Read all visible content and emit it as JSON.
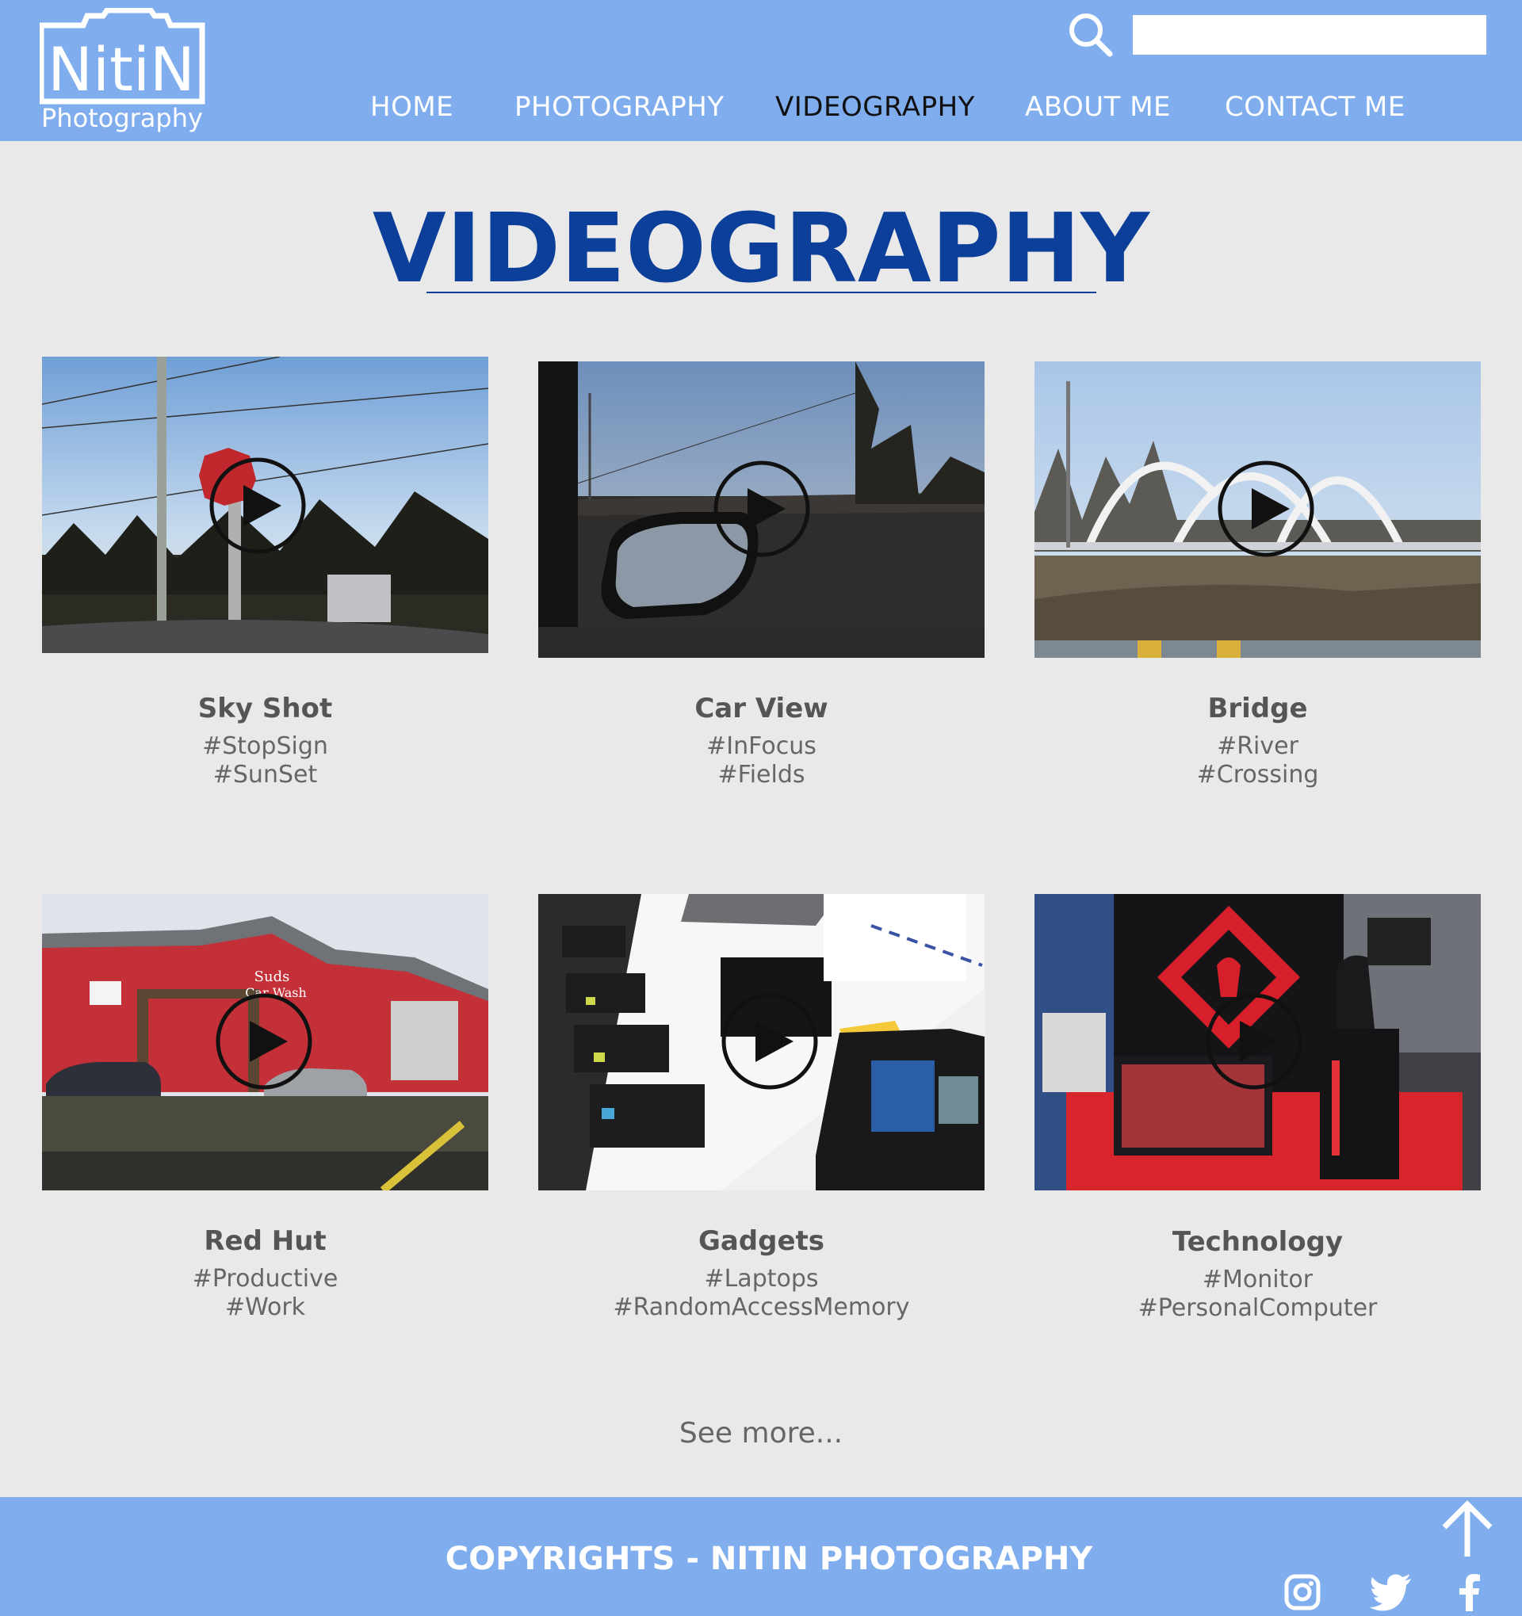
{
  "brand": {
    "name": "NitiN",
    "tagline": "Photography"
  },
  "search": {
    "placeholder": ""
  },
  "nav": {
    "home": "HOME",
    "photography": "PHOTOGRAPHY",
    "videography": "VIDEOGRAPHY",
    "about": "ABOUT ME",
    "contact": "CONTACT ME",
    "active": "videography"
  },
  "page": {
    "title": "VIDEOGRAPHY"
  },
  "videos": [
    {
      "title": "Sky Shot",
      "tags": [
        "#StopSign",
        "#SunSet"
      ],
      "thumb": "sky"
    },
    {
      "title": "Car View",
      "tags": [
        "#InFocus",
        "#Fields"
      ],
      "thumb": "car"
    },
    {
      "title": "Bridge",
      "tags": [
        "#River",
        "#Crossing"
      ],
      "thumb": "bridge"
    },
    {
      "title": "Red Hut",
      "tags": [
        "#Productive",
        "#Work"
      ],
      "thumb": "redhut"
    },
    {
      "title": "Gadgets",
      "tags": [
        "#Laptops",
        "#RandomAccessMemory"
      ],
      "thumb": "gadgets"
    },
    {
      "title": "Technology",
      "tags": [
        "#Monitor",
        "#PersonalComputer"
      ],
      "thumb": "technology"
    }
  ],
  "see_more": "See more...",
  "footer": {
    "copyright": "COPYRIGHTS - NITIN PHOTOGRAPHY",
    "social": [
      "instagram-icon",
      "twitter-icon",
      "facebook-icon"
    ]
  },
  "colors": {
    "header_bg": "#80adee",
    "page_bg": "#e9e9e9",
    "title": "#0b3f9a",
    "nav_active": "#111111"
  }
}
